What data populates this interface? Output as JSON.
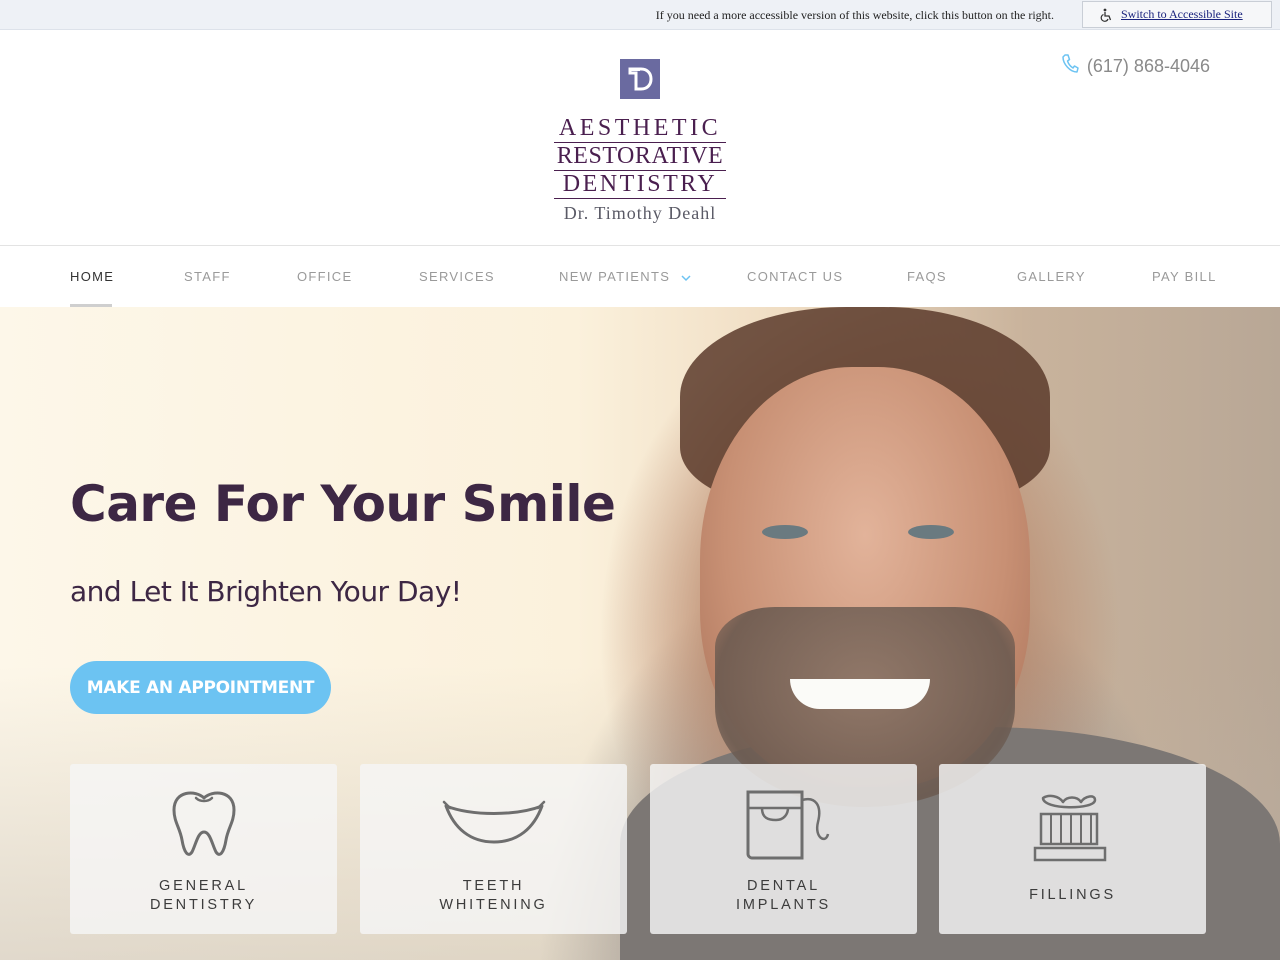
{
  "accessibility_bar": {
    "message": "If you need a more accessible version of this website, click this button on the right.",
    "button_label": "Switch to Accessible Site",
    "icon": "wheelchair-icon"
  },
  "header": {
    "logo": {
      "monogram": "D",
      "line1": "AESTHETIC",
      "line2": "RESTORATIVE",
      "line3": "DENTISTRY",
      "subtitle": "Dr. Timothy Deahl"
    },
    "phone": {
      "icon": "phone-icon",
      "number": "(617) 868-4046"
    }
  },
  "nav": {
    "items": [
      {
        "label": "HOME",
        "active": true
      },
      {
        "label": "STAFF",
        "active": false
      },
      {
        "label": "OFFICE",
        "active": false
      },
      {
        "label": "SERVICES",
        "active": false
      },
      {
        "label": "NEW PATIENTS",
        "active": false,
        "has_dropdown": true
      },
      {
        "label": "CONTACT US",
        "active": false
      },
      {
        "label": "FAQS",
        "active": false
      },
      {
        "label": "GALLERY",
        "active": false
      },
      {
        "label": "PAY BILL",
        "active": false
      }
    ]
  },
  "hero": {
    "title": "Care For Your Smile",
    "subtitle": "and Let It Brighten Your Day!",
    "cta_label": "MAKE AN APPOINTMENT"
  },
  "services": [
    {
      "line1": "GENERAL",
      "line2": "DENTISTRY",
      "icon": "tooth-icon"
    },
    {
      "line1": "TEETH",
      "line2": "WHITENING",
      "icon": "smile-icon"
    },
    {
      "line1": "DENTAL",
      "line2": "IMPLANTS",
      "icon": "floss-icon"
    },
    {
      "line1": "FILLINGS",
      "line2": "",
      "icon": "toothbrush-icon"
    }
  ],
  "colors": {
    "accent": "#6cc3f2",
    "brand_purple": "#4a1f4f",
    "logo_mark": "#6a6aa0",
    "heading": "#3d2744"
  }
}
